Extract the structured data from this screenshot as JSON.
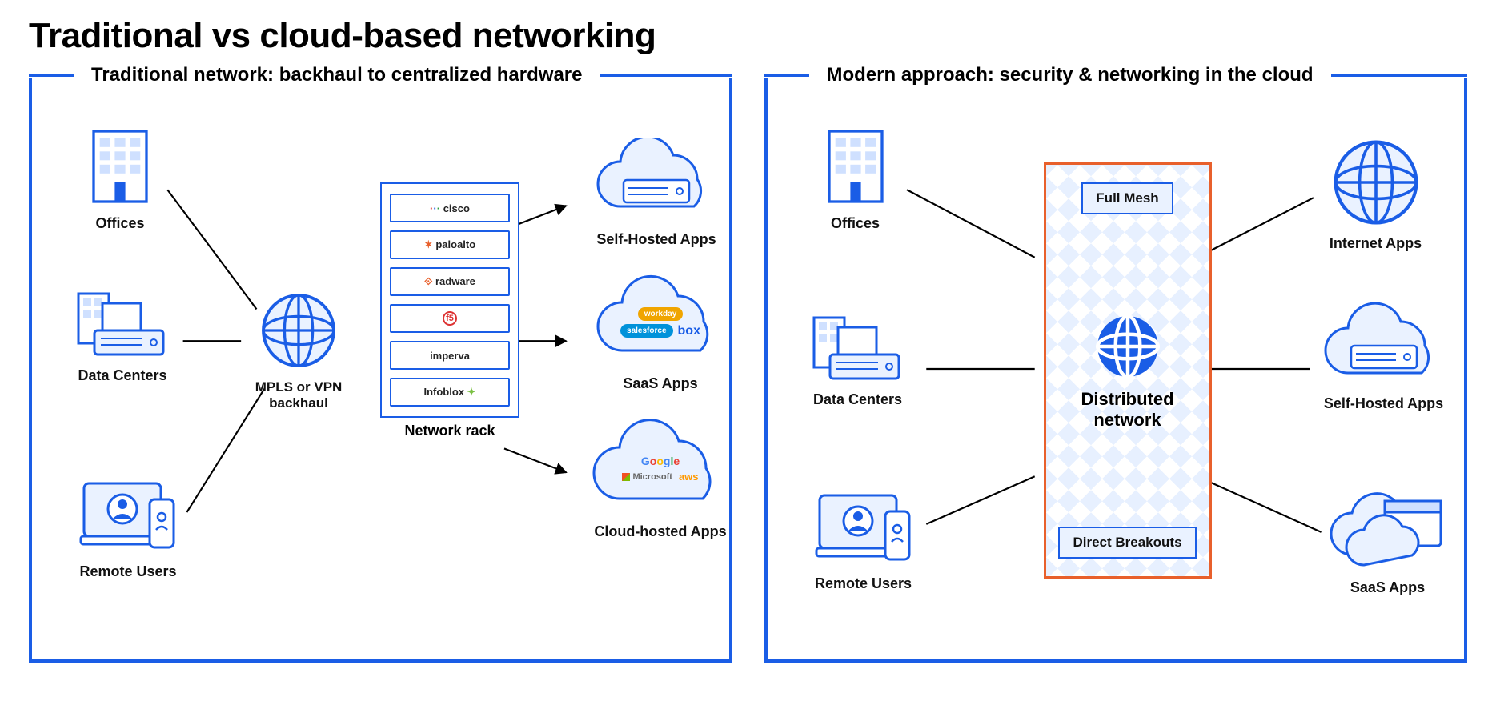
{
  "title": "Traditional vs cloud-based networking",
  "left": {
    "title": "Traditional network: backhaul to centralized hardware",
    "sources": {
      "offices": "Offices",
      "datacenters": "Data Centers",
      "remote": "Remote Users"
    },
    "hub": "MPLS or VPN backhaul",
    "rack": {
      "caption": "Network rack",
      "slots": [
        "cisco",
        "paloalto",
        "radware",
        "f5",
        "imperva",
        "Infoblox"
      ]
    },
    "apps": {
      "self": "Self-Hosted Apps",
      "saas": {
        "label": "SaaS Apps",
        "logos": [
          "workday",
          "salesforce",
          "box"
        ]
      },
      "cloud": {
        "label": "Cloud-hosted Apps",
        "logos": [
          "Google",
          "Microsoft",
          "aws"
        ]
      }
    }
  },
  "right": {
    "title": "Modern approach: security & networking in the cloud",
    "sources": {
      "offices": "Offices",
      "datacenters": "Data Centers",
      "remote": "Remote Users"
    },
    "dist": {
      "top": "Full Mesh",
      "center": "Distributed network",
      "bottom": "Direct Breakouts"
    },
    "apps": {
      "internet": "Internet Apps",
      "self": "Self-Hosted Apps",
      "saas": "SaaS Apps"
    }
  },
  "colors": {
    "primary": "#1a5de6",
    "orange": "#e8602c",
    "lightblue": "#eaf2ff"
  }
}
